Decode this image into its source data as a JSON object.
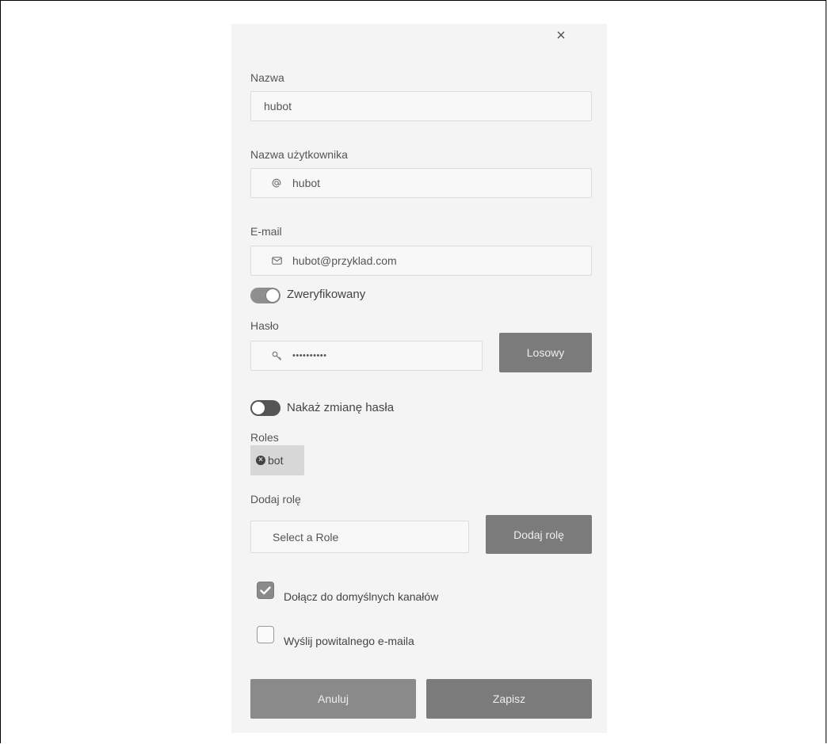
{
  "close_icon_glyph": "×",
  "fields": {
    "name": {
      "label": "Nazwa",
      "value": "hubot"
    },
    "username": {
      "label": "Nazwa użytkownika",
      "icon": "at-icon",
      "value": "hubot"
    },
    "email": {
      "label": "E-mail",
      "icon": "envelope-icon",
      "value": "hubot@przyklad.com"
    },
    "verified": {
      "label": "Zweryfikowany",
      "on": true
    },
    "password": {
      "label": "Hasło",
      "icon": "key-icon",
      "value": "••••••••••",
      "random_button": "Losowy"
    },
    "require_change": {
      "label": "Nakaż zmianę hasła",
      "on": false
    }
  },
  "roles": {
    "label": "Roles",
    "items": [
      {
        "name": "bot"
      }
    ],
    "add_label": "Dodaj rolę",
    "select_placeholder": "Select a Role",
    "add_button": "Dodaj rolę"
  },
  "checkboxes": {
    "join_default": {
      "label": "Dołącz do domyślnych kanałów",
      "checked": true
    },
    "send_welcome": {
      "label": "Wyślij powitalnego e-maila",
      "checked": false
    }
  },
  "actions": {
    "cancel": "Anuluj",
    "save": "Zapisz"
  },
  "colors": {
    "panel_bg": "#f4f4f4",
    "button_bg": "#7b7b7b",
    "chip_bg": "#d7d7d7"
  }
}
